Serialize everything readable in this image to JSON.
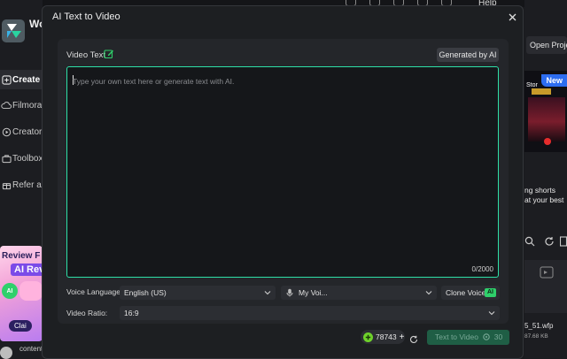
{
  "app": {
    "name": "Wondershare Filmora",
    "sidebar": [
      {
        "label": "Create Project",
        "icon": "create-icon"
      },
      {
        "label": "Filmora",
        "icon": "cloud-icon"
      },
      {
        "label": "Creator",
        "icon": "creator-icon"
      },
      {
        "label": "Toolbox",
        "icon": "toolbox-icon"
      },
      {
        "label": "Refer a",
        "icon": "refer-icon"
      }
    ],
    "promo": {
      "line1": "Review F",
      "line2": "AI Rev",
      "badge": "AI",
      "claim": "Clai"
    },
    "content_label": "content",
    "topbar": {
      "help": "Help"
    },
    "right": {
      "open_project": "Open Project",
      "new_badge": "New",
      "thumb_caption": "Stor",
      "shorts_text_1": "ng shorts",
      "shorts_text_2": "at your best",
      "file_name": "5_51.wfp",
      "file_size": "87.68 KB"
    }
  },
  "dialog": {
    "title": "AI Text to Video",
    "video_text_label": "Video Text",
    "generated_by_ai": "Generated by AI",
    "text_placeholder": "Type your own text here or generate text with AI.",
    "char_count": "0/2000",
    "voice_language_label": "Voice Language:",
    "voice_language_value": "English (US)",
    "voice_value": "My Voi...",
    "clone_voice_label": "Clone Voice",
    "clone_voice_badge": "AI",
    "video_ratio_label": "Video Ratio:",
    "video_ratio_value": "16:9",
    "credits": "78743",
    "text_to_video_label": "Text to Video",
    "text_to_video_cost": "30"
  },
  "colors": {
    "accent": "#2ee0a8",
    "ai_badge": "#2fd06b",
    "primary_button": "#1f5e45",
    "panel": "#24262a",
    "dialog": "#1d1f22"
  }
}
